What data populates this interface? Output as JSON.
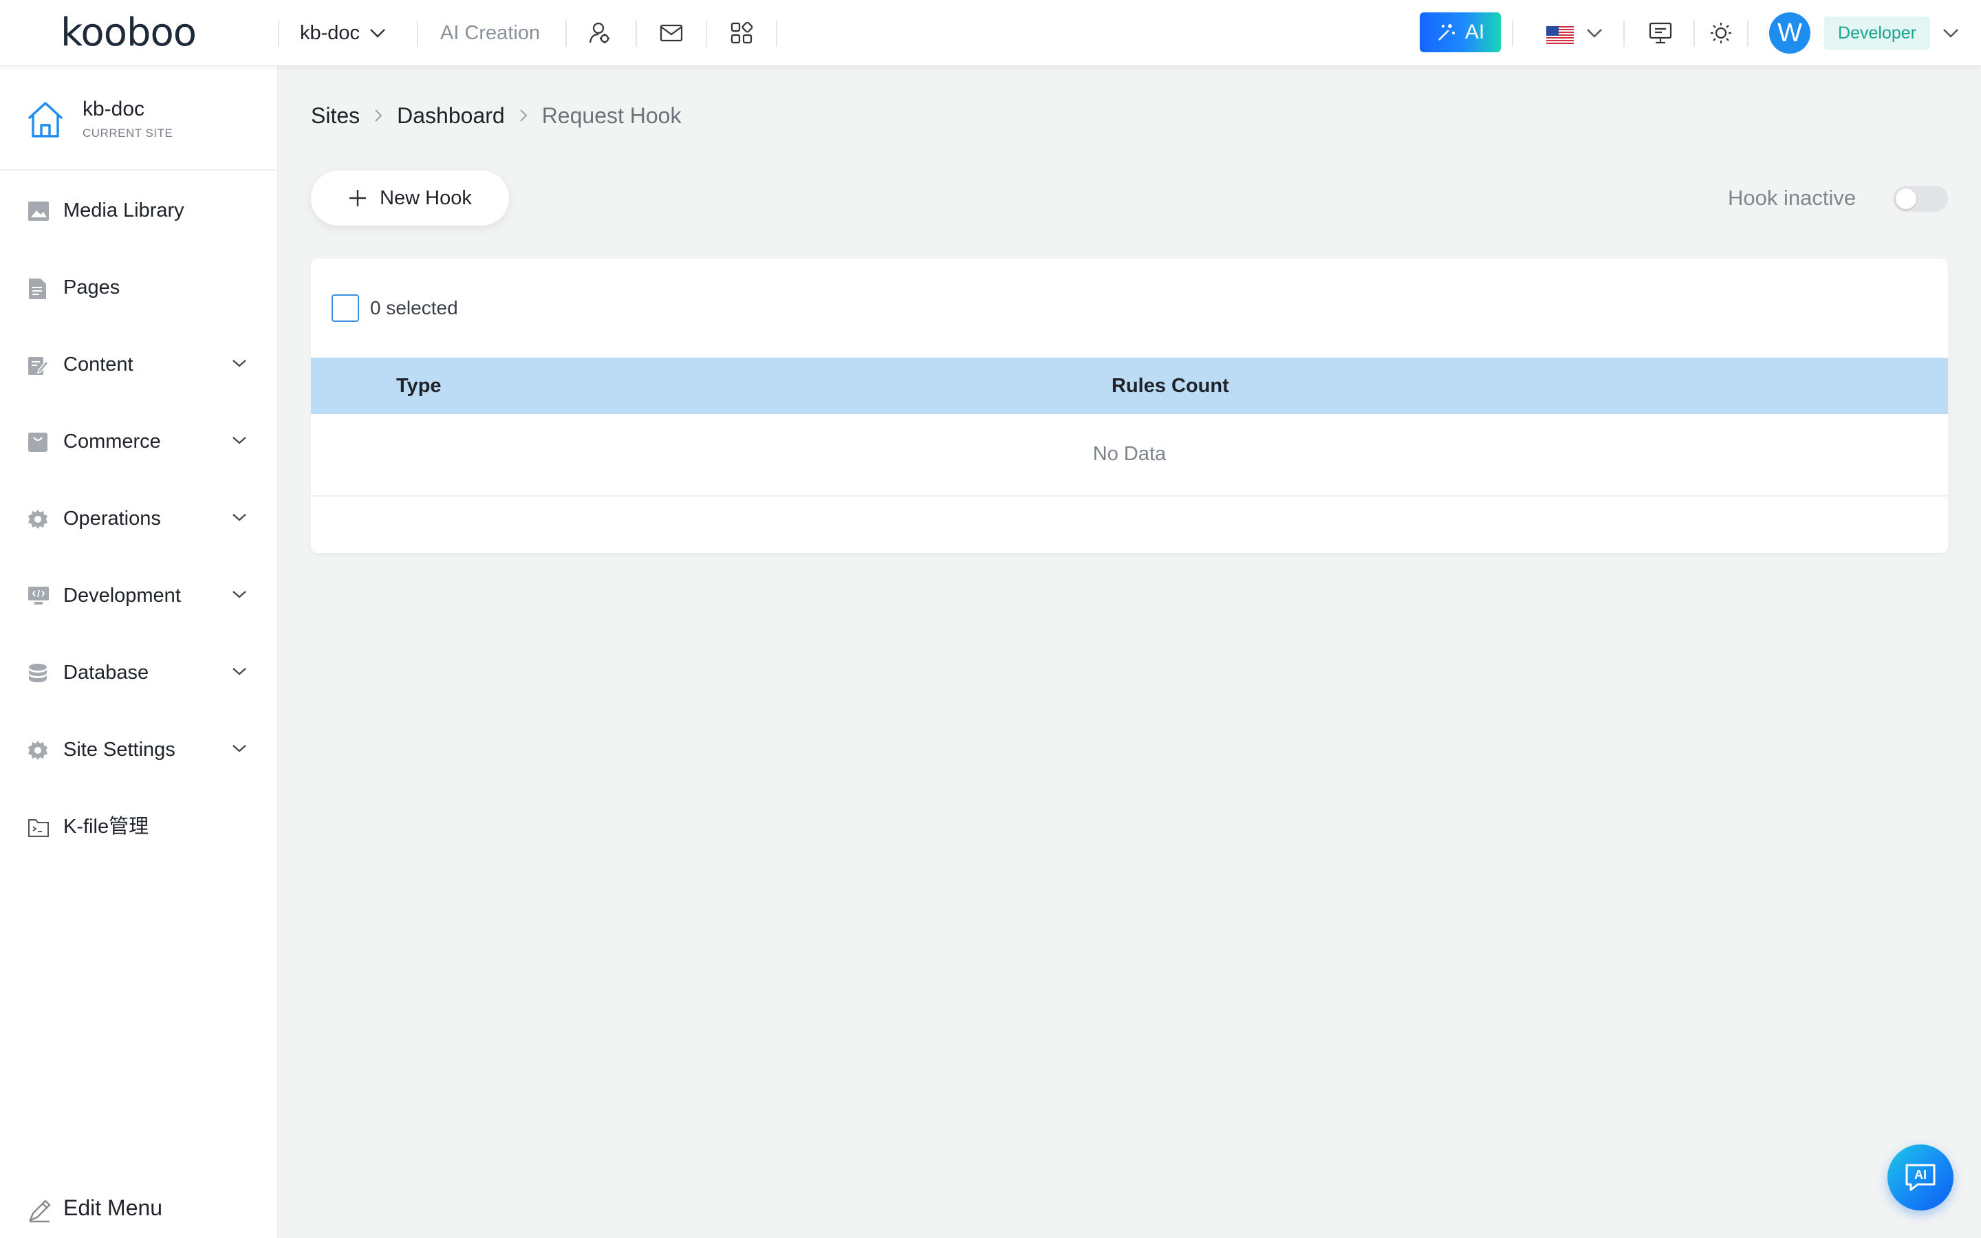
{
  "topbar": {
    "logo": "kooboo",
    "site_name": "kb-doc",
    "ai_creation": "AI Creation",
    "ai_button": "AI",
    "avatar_letter": "W",
    "role": "Developer"
  },
  "sidebar": {
    "current_site": {
      "name": "kb-doc",
      "caption": "CURRENT SITE"
    },
    "items": [
      {
        "label": "Media Library",
        "icon": "image-icon",
        "expandable": false
      },
      {
        "label": "Pages",
        "icon": "page-icon",
        "expandable": false
      },
      {
        "label": "Content",
        "icon": "content-icon",
        "expandable": true
      },
      {
        "label": "Commerce",
        "icon": "commerce-icon",
        "expandable": true
      },
      {
        "label": "Operations",
        "icon": "gear-icon",
        "expandable": true
      },
      {
        "label": "Development",
        "icon": "code-icon",
        "expandable": true
      },
      {
        "label": "Database",
        "icon": "database-icon",
        "expandable": true
      },
      {
        "label": "Site Settings",
        "icon": "gear-icon",
        "expandable": true
      },
      {
        "label": "K-file管理",
        "icon": "folder-icon",
        "expandable": false
      }
    ],
    "edit_menu": "Edit Menu"
  },
  "breadcrumb": [
    "Sites",
    "Dashboard",
    "Request Hook"
  ],
  "toolbar": {
    "new_hook": "New Hook",
    "hook_status": "Hook inactive"
  },
  "table": {
    "selected_count": "0 selected",
    "columns": [
      "Type",
      "Rules Count"
    ],
    "rows": [],
    "empty_text": "No Data"
  },
  "colors": {
    "accent": "#1f8cf0",
    "header_row": "#bcdcf6",
    "role_badge_text": "#1aa68d",
    "role_badge_bg": "#e3f6f4",
    "page_bg": "#f2f3f3"
  }
}
